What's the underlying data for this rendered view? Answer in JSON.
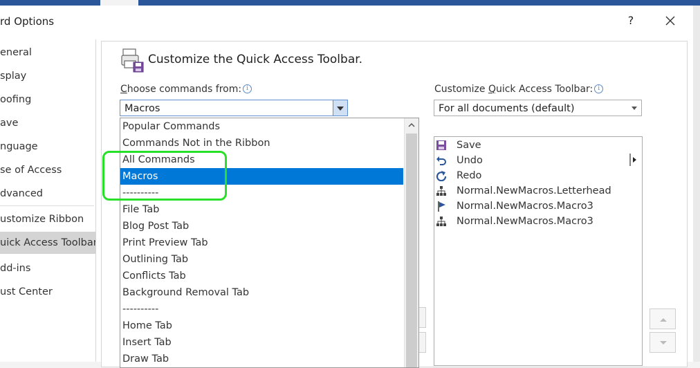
{
  "window": {
    "title": "rd Options",
    "help": "?",
    "close": "✕"
  },
  "sidebar": {
    "items": [
      {
        "label": "eneral",
        "top": 0
      },
      {
        "label": "splay"
      },
      {
        "label": "oofing"
      },
      {
        "label": "ave"
      },
      {
        "label": "nguage"
      },
      {
        "label": "se of Access"
      },
      {
        "label": "dvanced"
      },
      {
        "label": "ustomize Ribbon"
      },
      {
        "label": "uick Access Toolbar",
        "selected": true
      },
      {
        "label": "dd-ins"
      },
      {
        "label": "ust Center"
      }
    ]
  },
  "main": {
    "heading": "Customize the Quick Access Toolbar.",
    "choose_label_pre": "",
    "choose_label_acc": "C",
    "choose_label_post": "hoose commands from:",
    "choose_value": "Macros",
    "customize_label_pre": "Customize ",
    "customize_label_acc": "Q",
    "customize_label_post": "uick Access Toolbar:",
    "customize_value": "For all documents (default)",
    "info_glyph": "i"
  },
  "commands_list": [
    "Popular Commands",
    "Commands Not in the Ribbon",
    "All Commands",
    "Macros",
    "----------",
    "File Tab",
    "Blog Post Tab",
    "Print Preview Tab",
    "Outlining Tab",
    "Conflicts Tab",
    "Background Removal Tab",
    "----------",
    "Home Tab",
    "Insert Tab",
    "Draw Tab"
  ],
  "selected_command": "Macros",
  "qat_items": [
    {
      "label": "Save",
      "icon": "save-icon"
    },
    {
      "label": "Undo",
      "icon": "undo-icon"
    },
    {
      "label": "Redo",
      "icon": "redo-icon"
    },
    {
      "label": "Normal.NewMacros.Letterhead",
      "icon": "macro-icon"
    },
    {
      "label": "Normal.NewMacros.Macro3",
      "icon": "flag-icon"
    },
    {
      "label": "Normal.NewMacros.Macro3",
      "icon": "macro-icon"
    }
  ],
  "colors": {
    "selection": "#0078d7",
    "highlight": "#28e028",
    "accent": "#2b579a"
  }
}
